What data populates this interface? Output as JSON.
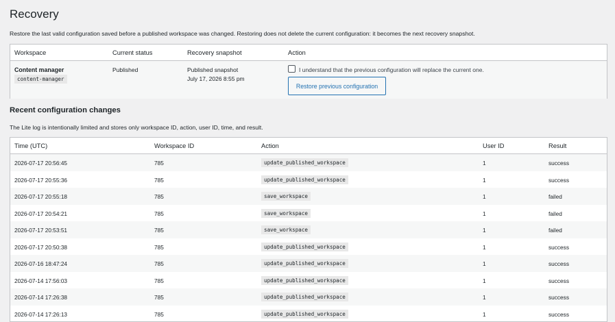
{
  "page": {
    "title": "Recovery",
    "intro": "Restore the last valid configuration saved before a published workspace was changed. Restoring does not delete the current configuration: it becomes the next recovery snapshot."
  },
  "recovery_table": {
    "headers": {
      "workspace": "Workspace",
      "status": "Current status",
      "snapshot": "Recovery snapshot",
      "action": "Action"
    },
    "row": {
      "workspace_name": "Content manager",
      "workspace_slug": "content-manager",
      "status": "Published",
      "snapshot_label": "Published snapshot",
      "snapshot_date": "July 17, 2026 8:55 pm",
      "confirm_label": "I understand that the previous configuration will replace the current one.",
      "confirm_checked": false,
      "restore_button": "Restore previous configuration"
    }
  },
  "log": {
    "title": "Recent configuration changes",
    "description": "The Lite log is intentionally limited and stores only workspace ID, action, user ID, time, and result.",
    "headers": {
      "time": "Time (UTC)",
      "workspace_id": "Workspace ID",
      "action": "Action",
      "user_id": "User ID",
      "result": "Result"
    },
    "rows": [
      {
        "time": "2026-07-17 20:56:45",
        "workspace_id": "785",
        "action": "update_published_workspace",
        "user_id": "1",
        "result": "success"
      },
      {
        "time": "2026-07-17 20:55:36",
        "workspace_id": "785",
        "action": "update_published_workspace",
        "user_id": "1",
        "result": "success"
      },
      {
        "time": "2026-07-17 20:55:18",
        "workspace_id": "785",
        "action": "save_workspace",
        "user_id": "1",
        "result": "failed"
      },
      {
        "time": "2026-07-17 20:54:21",
        "workspace_id": "785",
        "action": "save_workspace",
        "user_id": "1",
        "result": "failed"
      },
      {
        "time": "2026-07-17 20:53:51",
        "workspace_id": "785",
        "action": "save_workspace",
        "user_id": "1",
        "result": "failed"
      },
      {
        "time": "2026-07-17 20:50:38",
        "workspace_id": "785",
        "action": "update_published_workspace",
        "user_id": "1",
        "result": "success"
      },
      {
        "time": "2026-07-16 18:47:24",
        "workspace_id": "785",
        "action": "update_published_workspace",
        "user_id": "1",
        "result": "success"
      },
      {
        "time": "2026-07-14 17:56:03",
        "workspace_id": "785",
        "action": "update_published_workspace",
        "user_id": "1",
        "result": "success"
      },
      {
        "time": "2026-07-14 17:26:38",
        "workspace_id": "785",
        "action": "update_published_workspace",
        "user_id": "1",
        "result": "success"
      },
      {
        "time": "2026-07-14 17:26:13",
        "workspace_id": "785",
        "action": "update_published_workspace",
        "user_id": "1",
        "result": "success"
      }
    ]
  }
}
